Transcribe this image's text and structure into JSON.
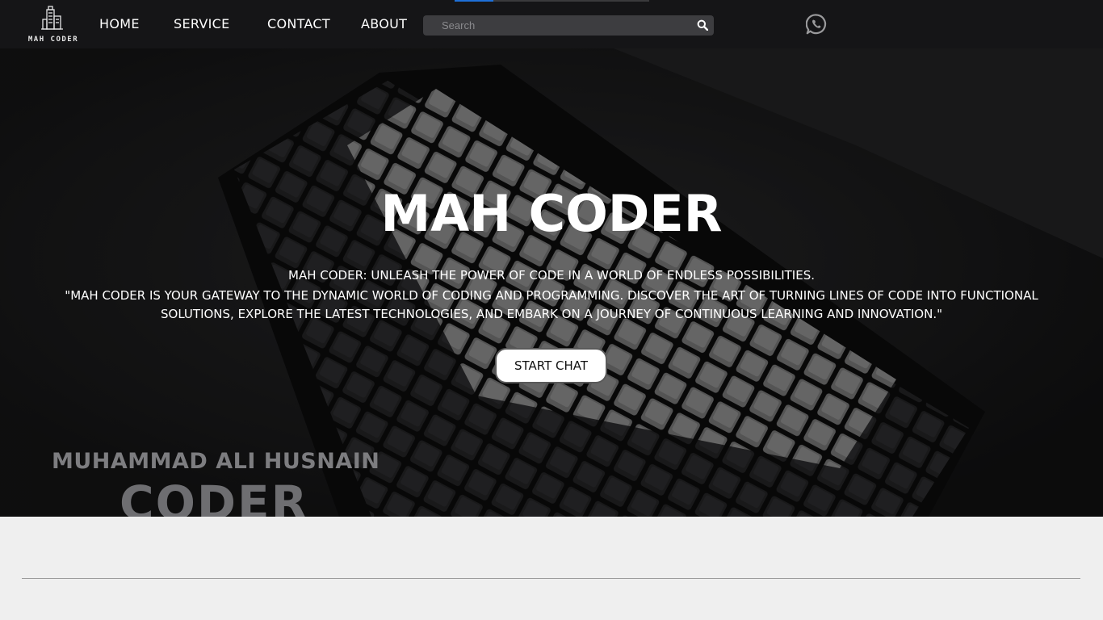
{
  "nav": {
    "logo_text": "MAH CODER",
    "links": [
      "HOME",
      "SERVICE",
      "CONTACT",
      "ABOUT"
    ],
    "search_placeholder": "Search",
    "search_icon": "search-icon",
    "whatsapp_icon": "whatsapp-icon",
    "page_progress": 0.2
  },
  "hero": {
    "title": "MAH CODER",
    "tagline": "MAH CODER: UNLEASH THE POWER OF CODE IN A WORLD OF ENDLESS POSSIBILITIES.",
    "description": "\"MAH CODER IS YOUR GATEWAY TO THE DYNAMIC WORLD OF CODING AND PROGRAMMING. DISCOVER THE ART OF TURNING LINES OF CODE INTO FUNCTIONAL SOLUTIONS, EXPLORE THE LATEST TECHNOLOGIES, AND EMBARK ON A JOURNEY OF CONTINUOUS LEARNING AND INNOVATION.\"",
    "button_label": "START CHAT",
    "watermark_name": "MUHAMMAD ALI HUSNAIN",
    "watermark_word": "CODER"
  },
  "colors": {
    "nav_bg": "#151517",
    "accent": "#1e6fd8",
    "page_bg": "#efefef"
  }
}
